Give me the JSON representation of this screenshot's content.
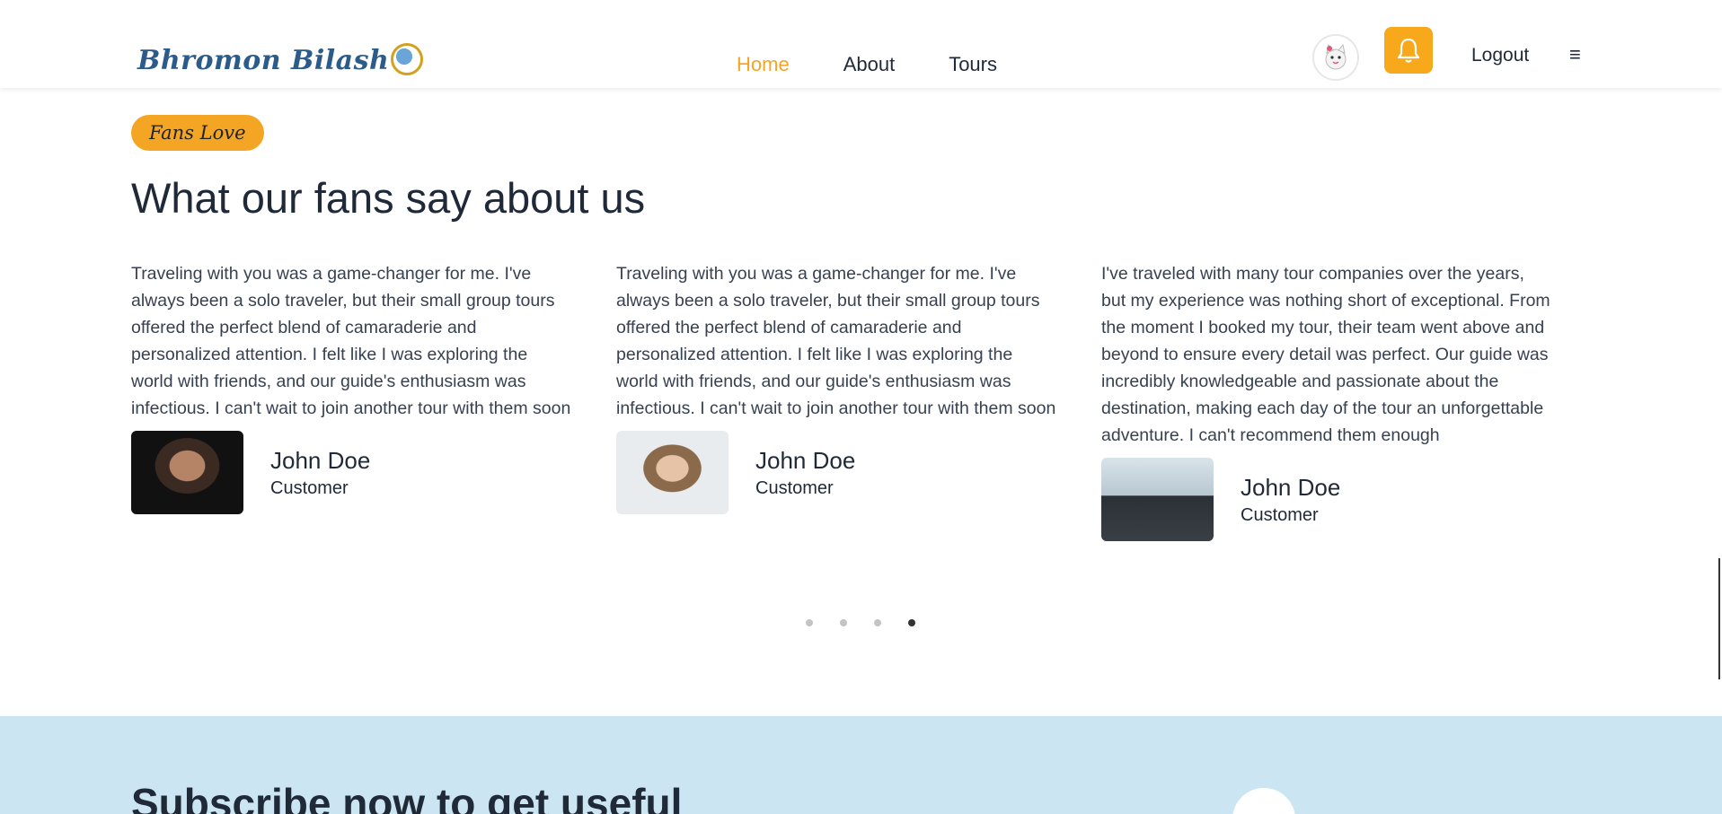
{
  "brand": {
    "name": "Bhromon Bilash"
  },
  "nav": {
    "links": [
      {
        "label": "Home",
        "active": true
      },
      {
        "label": "About",
        "active": false
      },
      {
        "label": "Tours",
        "active": false
      }
    ],
    "logout_label": "Logout",
    "menu_icon": "≡"
  },
  "testimonials": {
    "badge": "Fans Love",
    "heading": "What our fans say about us",
    "items": [
      {
        "quote": "Traveling with you was a game-changer for me. I've always been a solo traveler, but their small group tours offered the perfect blend of camaraderie and personalized attention. I felt like I was exploring the world with friends, and our guide's enthusiasm was infectious. I can't wait to join another tour with them soon",
        "name": "John Doe",
        "role": "Customer"
      },
      {
        "quote": "Traveling with you was a game-changer for me. I've always been a solo traveler, but their small group tours offered the perfect blend of camaraderie and personalized attention. I felt like I was exploring the world with friends, and our guide's enthusiasm was infectious. I can't wait to join another tour with them soon",
        "name": "John Doe",
        "role": "Customer"
      },
      {
        "quote": "I've traveled with many tour companies over the years, but my experience was nothing short of exceptional. From the moment I booked my tour, their team went above and beyond to ensure every detail was perfect. Our guide was incredibly knowledgeable and passionate about the destination, making each day of the tour an unforgettable adventure. I can't recommend them enough",
        "name": "John Doe",
        "role": "Customer"
      }
    ],
    "pagination": {
      "total": 4,
      "active_index": 3
    }
  },
  "subscribe": {
    "title": "Subscribe now to get useful"
  },
  "colors": {
    "accent": "#f5a524",
    "subscribe_bg": "#cce5f3",
    "brand_text": "#2a5b8a"
  }
}
